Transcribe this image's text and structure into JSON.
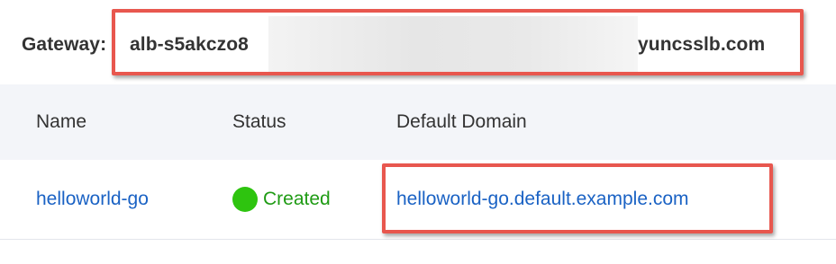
{
  "gateway": {
    "label": "Gateway:",
    "value_start": "alb-s5akczo8",
    "value_end": "yuncsslb.com"
  },
  "table": {
    "columns": [
      "Name",
      "Status",
      "Default Domain"
    ],
    "rows": [
      {
        "name": "helloworld-go",
        "status": "Created",
        "status_color": "#2ec40f",
        "default_domain": "helloworld-go.default.example.com"
      }
    ]
  },
  "colors": {
    "highlight": "#e8574e",
    "link": "#1a62c4",
    "status_text": "#1f9b14",
    "header_bg": "#f3f5f9"
  }
}
